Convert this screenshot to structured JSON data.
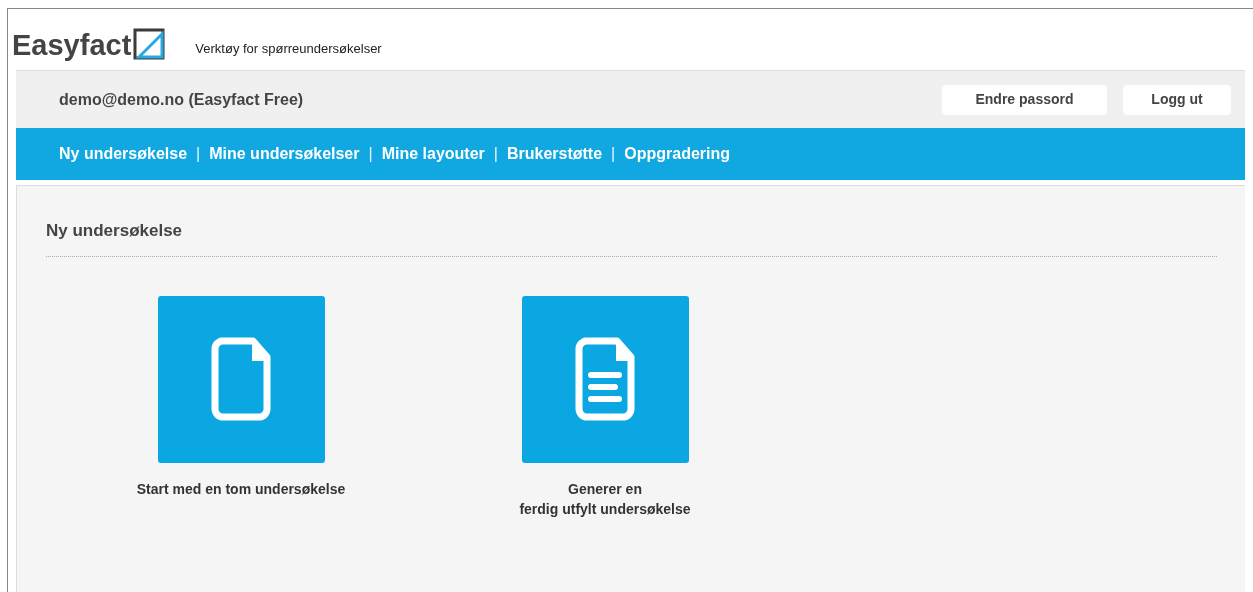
{
  "header": {
    "logo": "Easyfact",
    "tagline": "Verktøy for spørreundersøkelser"
  },
  "account_bar": {
    "user": "demo@demo.no (Easyfact Free)",
    "buttons": [
      "Endre passord",
      "Logg ut"
    ]
  },
  "nav": [
    {
      "kind": "link",
      "text": "Ny undersøkelse"
    },
    {
      "kind": "separator",
      "text": "|"
    },
    {
      "kind": "link",
      "text": "Mine undersøkelser"
    },
    {
      "kind": "separator",
      "text": "|"
    },
    {
      "kind": "link",
      "text": "Mine layouter"
    },
    {
      "kind": "separator",
      "text": "|"
    },
    {
      "kind": "link",
      "text": "Brukerstøtte"
    },
    {
      "kind": "separator",
      "text": "|"
    },
    {
      "kind": "link",
      "text": "Oppgradering"
    }
  ],
  "section": {
    "title": "Ny undersøkelse",
    "options": [
      {
        "kind": "blank",
        "lines": [
          "Start med en tom undersøkelse"
        ]
      },
      {
        "kind": "filled",
        "lines": [
          "Generer en",
          "ferdig utfylt undersøkelse"
        ]
      }
    ]
  }
}
